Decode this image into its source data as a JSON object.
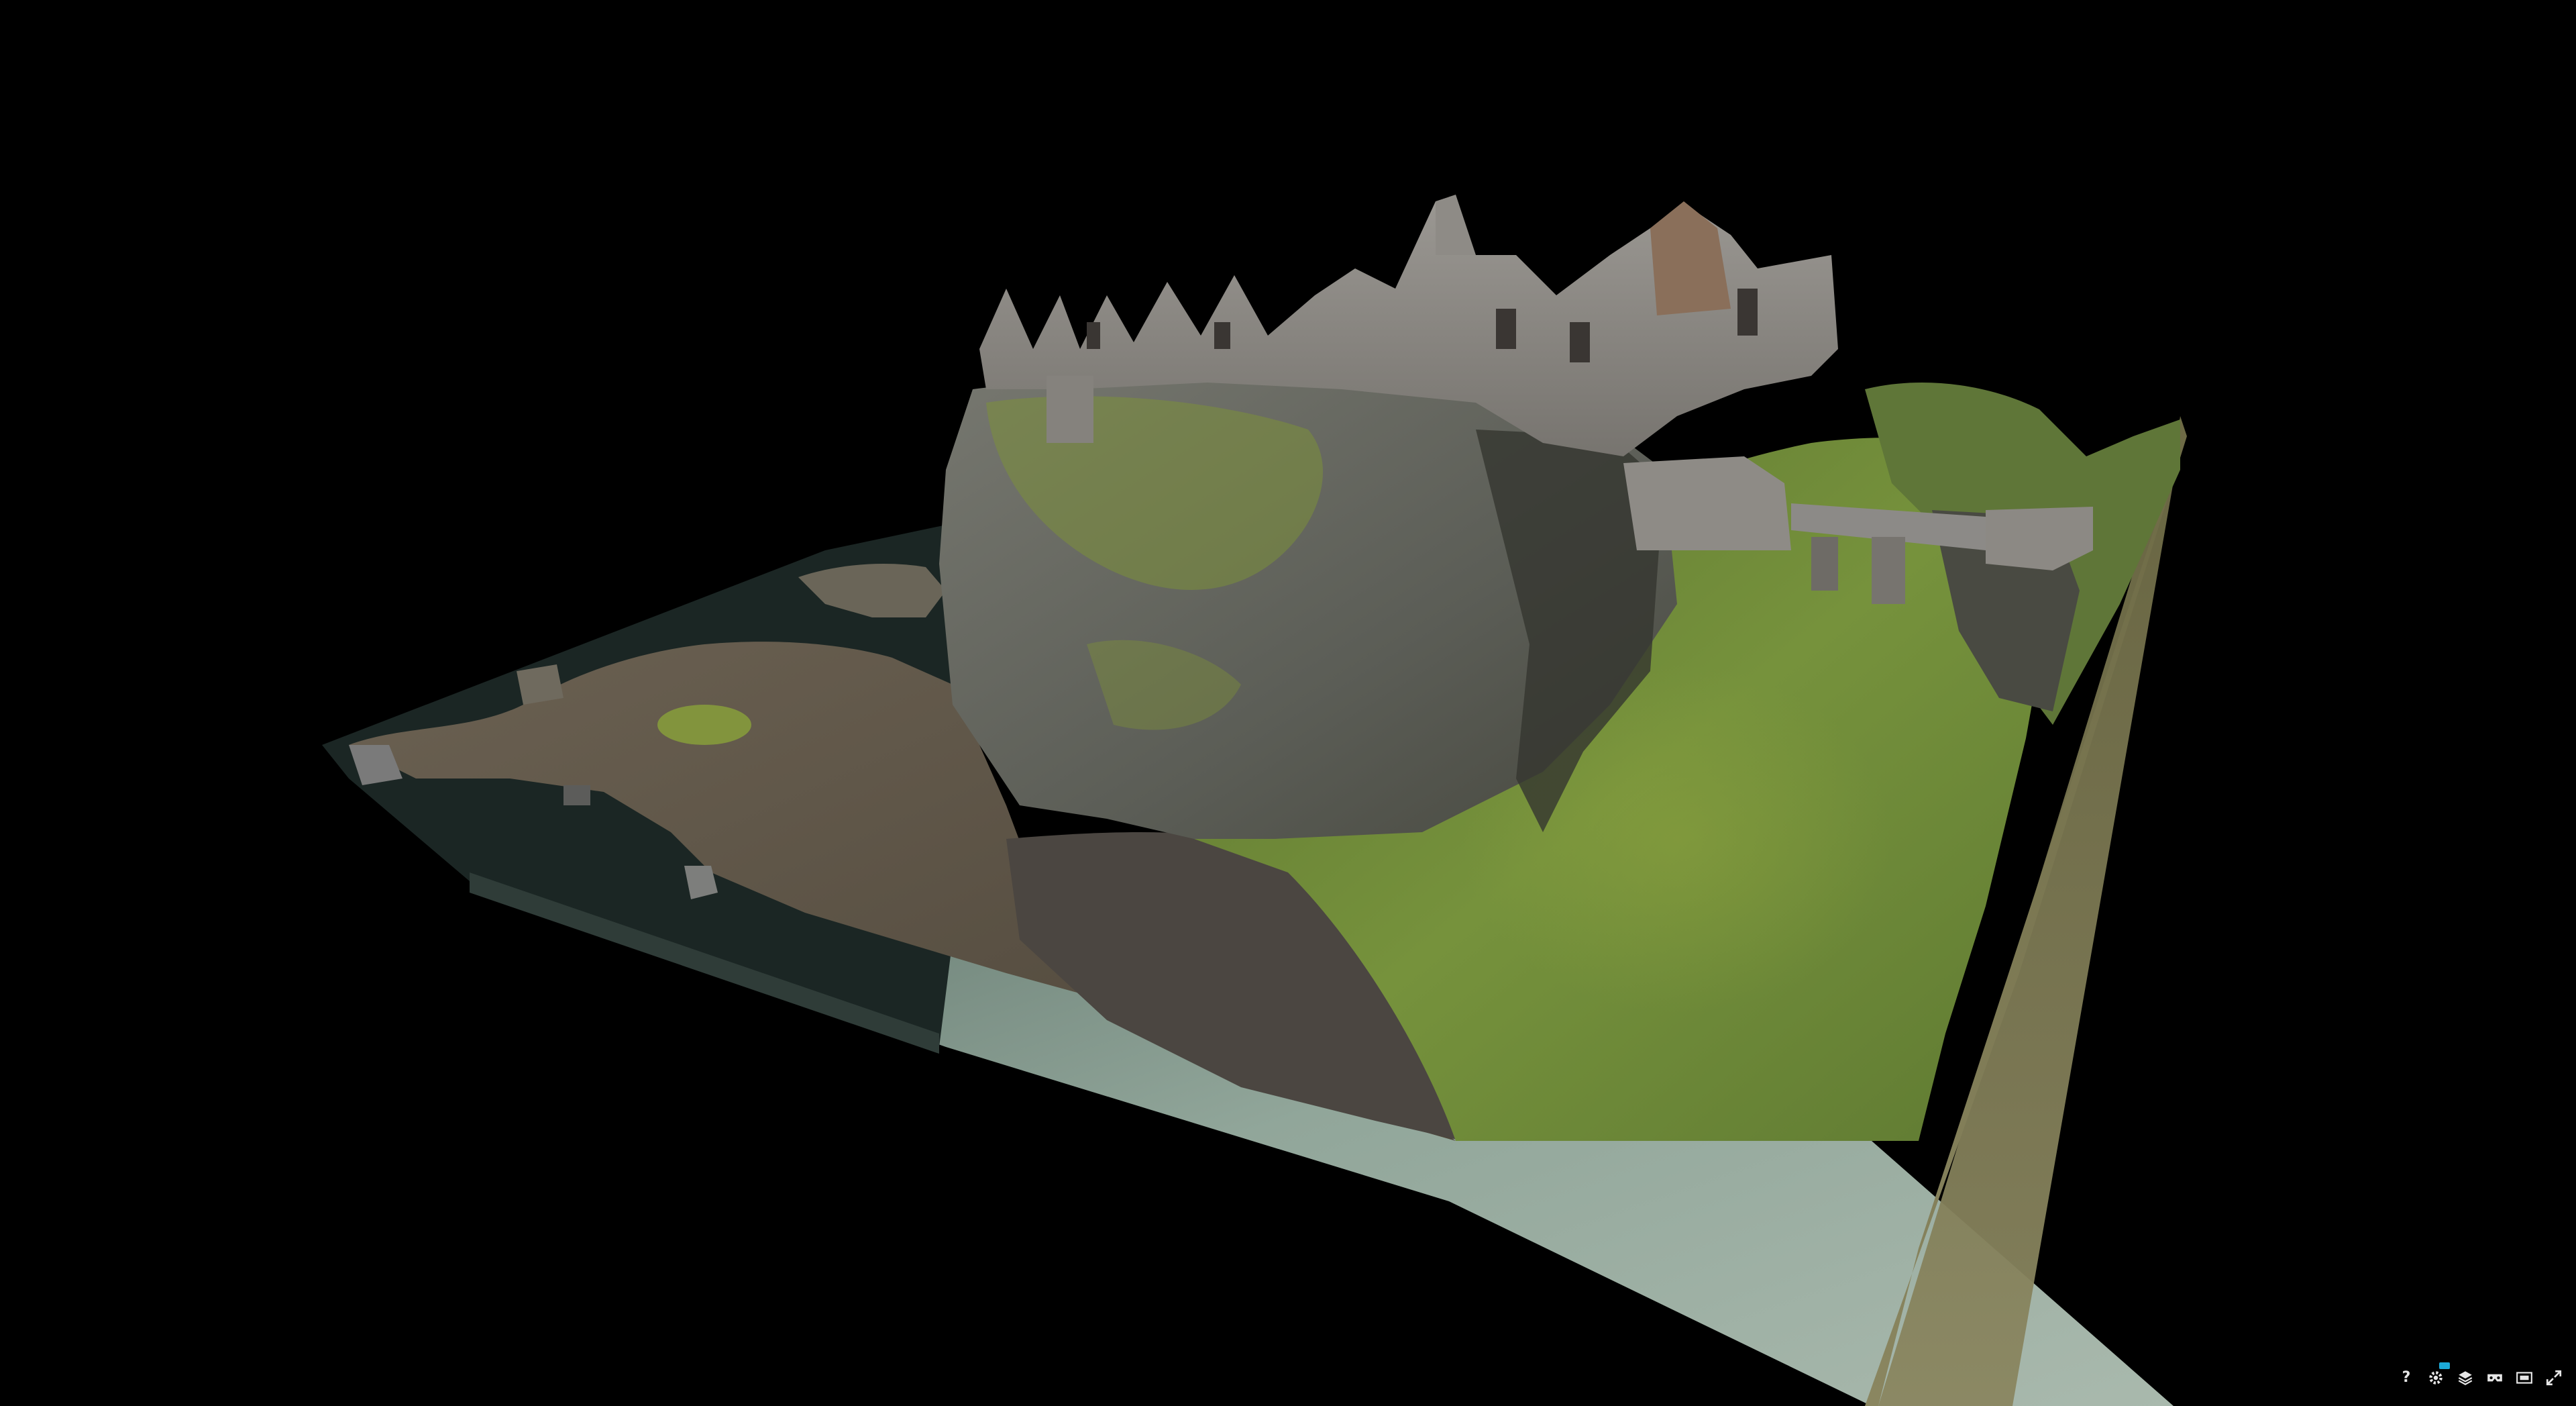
{
  "viewer": {
    "background_color": "#000000",
    "subject": "3d-model-castle-ruin-on-cliff",
    "palette": {
      "grass": "#6f8a3a",
      "grass_dark": "#4a5d2a",
      "rock": "#6e6f6a",
      "rock_dark": "#3c3d3a",
      "stone_wall": "#8a8782",
      "scree": "#4a4642",
      "water": "#1e2a28",
      "base_front": "#9fb0a3",
      "base_side": "#7d7a52"
    }
  },
  "toolbar": {
    "help_label": "?",
    "items": [
      {
        "name": "help-button",
        "icon": "question-icon"
      },
      {
        "name": "settings-button",
        "icon": "gear-icon"
      },
      {
        "name": "layers-button",
        "icon": "layers-icon"
      },
      {
        "name": "vr-button",
        "icon": "vr-headset-icon"
      },
      {
        "name": "theatre-mode-button",
        "icon": "theatre-icon"
      },
      {
        "name": "fullscreen-button",
        "icon": "fullscreen-icon"
      }
    ],
    "accent_color": "#1caad9"
  }
}
